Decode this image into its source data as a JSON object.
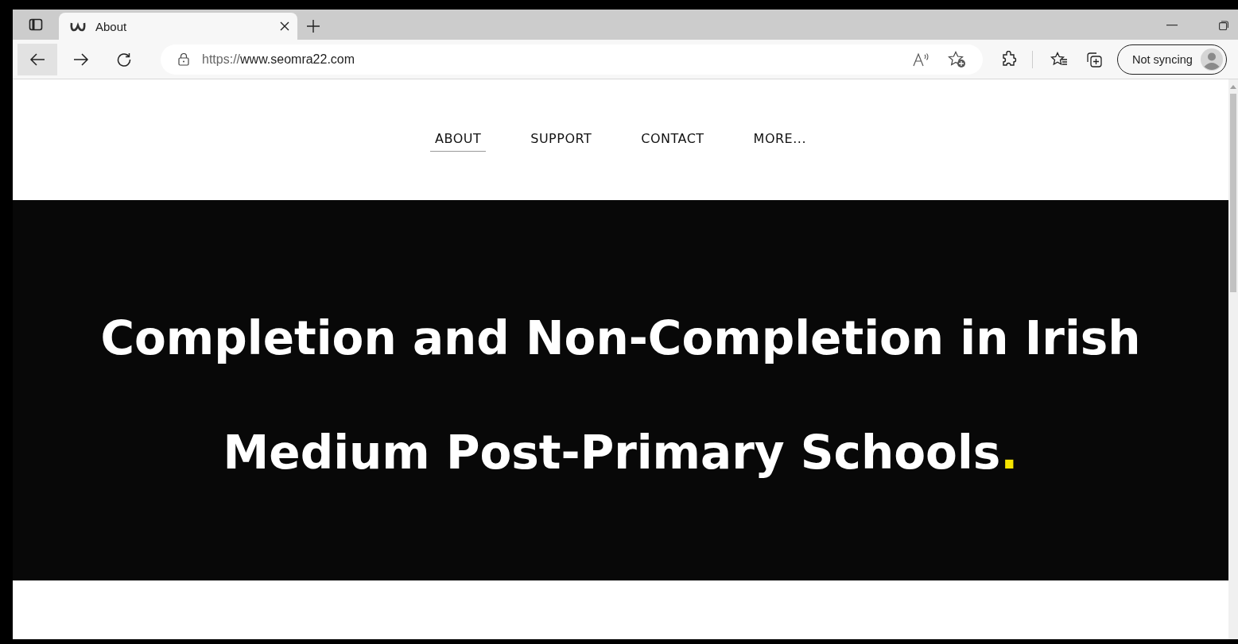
{
  "browser": {
    "tabs": [
      {
        "title": "About",
        "selected": true
      }
    ],
    "address": {
      "scheme": "https://",
      "host": "www.seomra22.com"
    },
    "profile": {
      "label": "Not syncing"
    }
  },
  "nav": {
    "items": [
      {
        "label": "ABOUT",
        "selected": true
      },
      {
        "label": "SUPPORT",
        "selected": false
      },
      {
        "label": "CONTACT",
        "selected": false
      },
      {
        "label": "MORE...",
        "selected": false
      }
    ]
  },
  "hero": {
    "title_lines": [
      "Completion and Non-Completion in Irish",
      "Medium Post-Primary Schools"
    ],
    "accent": "."
  }
}
